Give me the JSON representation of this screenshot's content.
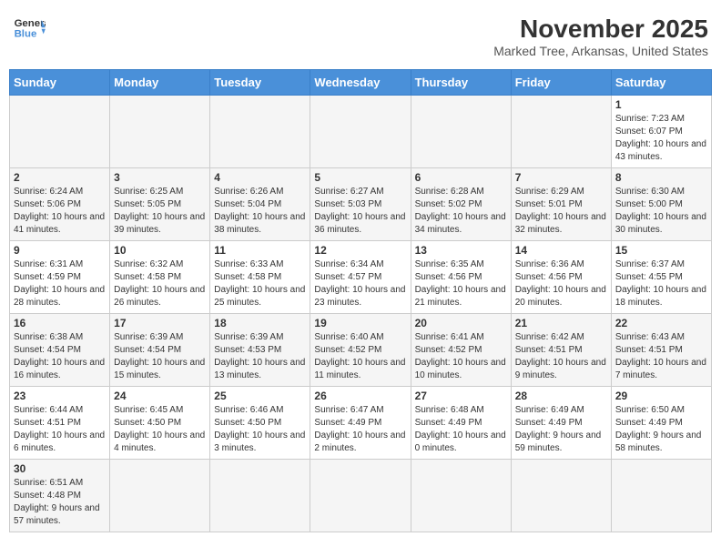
{
  "header": {
    "logo_general": "General",
    "logo_blue": "Blue",
    "month": "November 2025",
    "location": "Marked Tree, Arkansas, United States"
  },
  "days_of_week": [
    "Sunday",
    "Monday",
    "Tuesday",
    "Wednesday",
    "Thursday",
    "Friday",
    "Saturday"
  ],
  "weeks": [
    [
      {
        "day": "",
        "info": "",
        "empty": true
      },
      {
        "day": "",
        "info": "",
        "empty": true
      },
      {
        "day": "",
        "info": "",
        "empty": true
      },
      {
        "day": "",
        "info": "",
        "empty": true
      },
      {
        "day": "",
        "info": "",
        "empty": true
      },
      {
        "day": "",
        "info": "",
        "empty": true
      },
      {
        "day": "1",
        "info": "Sunrise: 7:23 AM\nSunset: 6:07 PM\nDaylight: 10 hours and 43 minutes."
      }
    ],
    [
      {
        "day": "2",
        "info": "Sunrise: 6:24 AM\nSunset: 5:06 PM\nDaylight: 10 hours and 41 minutes."
      },
      {
        "day": "3",
        "info": "Sunrise: 6:25 AM\nSunset: 5:05 PM\nDaylight: 10 hours and 39 minutes."
      },
      {
        "day": "4",
        "info": "Sunrise: 6:26 AM\nSunset: 5:04 PM\nDaylight: 10 hours and 38 minutes."
      },
      {
        "day": "5",
        "info": "Sunrise: 6:27 AM\nSunset: 5:03 PM\nDaylight: 10 hours and 36 minutes."
      },
      {
        "day": "6",
        "info": "Sunrise: 6:28 AM\nSunset: 5:02 PM\nDaylight: 10 hours and 34 minutes."
      },
      {
        "day": "7",
        "info": "Sunrise: 6:29 AM\nSunset: 5:01 PM\nDaylight: 10 hours and 32 minutes."
      },
      {
        "day": "8",
        "info": "Sunrise: 6:30 AM\nSunset: 5:00 PM\nDaylight: 10 hours and 30 minutes."
      }
    ],
    [
      {
        "day": "9",
        "info": "Sunrise: 6:31 AM\nSunset: 4:59 PM\nDaylight: 10 hours and 28 minutes."
      },
      {
        "day": "10",
        "info": "Sunrise: 6:32 AM\nSunset: 4:58 PM\nDaylight: 10 hours and 26 minutes."
      },
      {
        "day": "11",
        "info": "Sunrise: 6:33 AM\nSunset: 4:58 PM\nDaylight: 10 hours and 25 minutes."
      },
      {
        "day": "12",
        "info": "Sunrise: 6:34 AM\nSunset: 4:57 PM\nDaylight: 10 hours and 23 minutes."
      },
      {
        "day": "13",
        "info": "Sunrise: 6:35 AM\nSunset: 4:56 PM\nDaylight: 10 hours and 21 minutes."
      },
      {
        "day": "14",
        "info": "Sunrise: 6:36 AM\nSunset: 4:56 PM\nDaylight: 10 hours and 20 minutes."
      },
      {
        "day": "15",
        "info": "Sunrise: 6:37 AM\nSunset: 4:55 PM\nDaylight: 10 hours and 18 minutes."
      }
    ],
    [
      {
        "day": "16",
        "info": "Sunrise: 6:38 AM\nSunset: 4:54 PM\nDaylight: 10 hours and 16 minutes."
      },
      {
        "day": "17",
        "info": "Sunrise: 6:39 AM\nSunset: 4:54 PM\nDaylight: 10 hours and 15 minutes."
      },
      {
        "day": "18",
        "info": "Sunrise: 6:39 AM\nSunset: 4:53 PM\nDaylight: 10 hours and 13 minutes."
      },
      {
        "day": "19",
        "info": "Sunrise: 6:40 AM\nSunset: 4:52 PM\nDaylight: 10 hours and 11 minutes."
      },
      {
        "day": "20",
        "info": "Sunrise: 6:41 AM\nSunset: 4:52 PM\nDaylight: 10 hours and 10 minutes."
      },
      {
        "day": "21",
        "info": "Sunrise: 6:42 AM\nSunset: 4:51 PM\nDaylight: 10 hours and 9 minutes."
      },
      {
        "day": "22",
        "info": "Sunrise: 6:43 AM\nSunset: 4:51 PM\nDaylight: 10 hours and 7 minutes."
      }
    ],
    [
      {
        "day": "23",
        "info": "Sunrise: 6:44 AM\nSunset: 4:51 PM\nDaylight: 10 hours and 6 minutes."
      },
      {
        "day": "24",
        "info": "Sunrise: 6:45 AM\nSunset: 4:50 PM\nDaylight: 10 hours and 4 minutes."
      },
      {
        "day": "25",
        "info": "Sunrise: 6:46 AM\nSunset: 4:50 PM\nDaylight: 10 hours and 3 minutes."
      },
      {
        "day": "26",
        "info": "Sunrise: 6:47 AM\nSunset: 4:49 PM\nDaylight: 10 hours and 2 minutes."
      },
      {
        "day": "27",
        "info": "Sunrise: 6:48 AM\nSunset: 4:49 PM\nDaylight: 10 hours and 0 minutes."
      },
      {
        "day": "28",
        "info": "Sunrise: 6:49 AM\nSunset: 4:49 PM\nDaylight: 9 hours and 59 minutes."
      },
      {
        "day": "29",
        "info": "Sunrise: 6:50 AM\nSunset: 4:49 PM\nDaylight: 9 hours and 58 minutes."
      }
    ],
    [
      {
        "day": "30",
        "info": "Sunrise: 6:51 AM\nSunset: 4:48 PM\nDaylight: 9 hours and 57 minutes."
      },
      {
        "day": "",
        "info": "",
        "empty": true
      },
      {
        "day": "",
        "info": "",
        "empty": true
      },
      {
        "day": "",
        "info": "",
        "empty": true
      },
      {
        "day": "",
        "info": "",
        "empty": true
      },
      {
        "day": "",
        "info": "",
        "empty": true
      },
      {
        "day": "",
        "info": "",
        "empty": true
      }
    ]
  ]
}
